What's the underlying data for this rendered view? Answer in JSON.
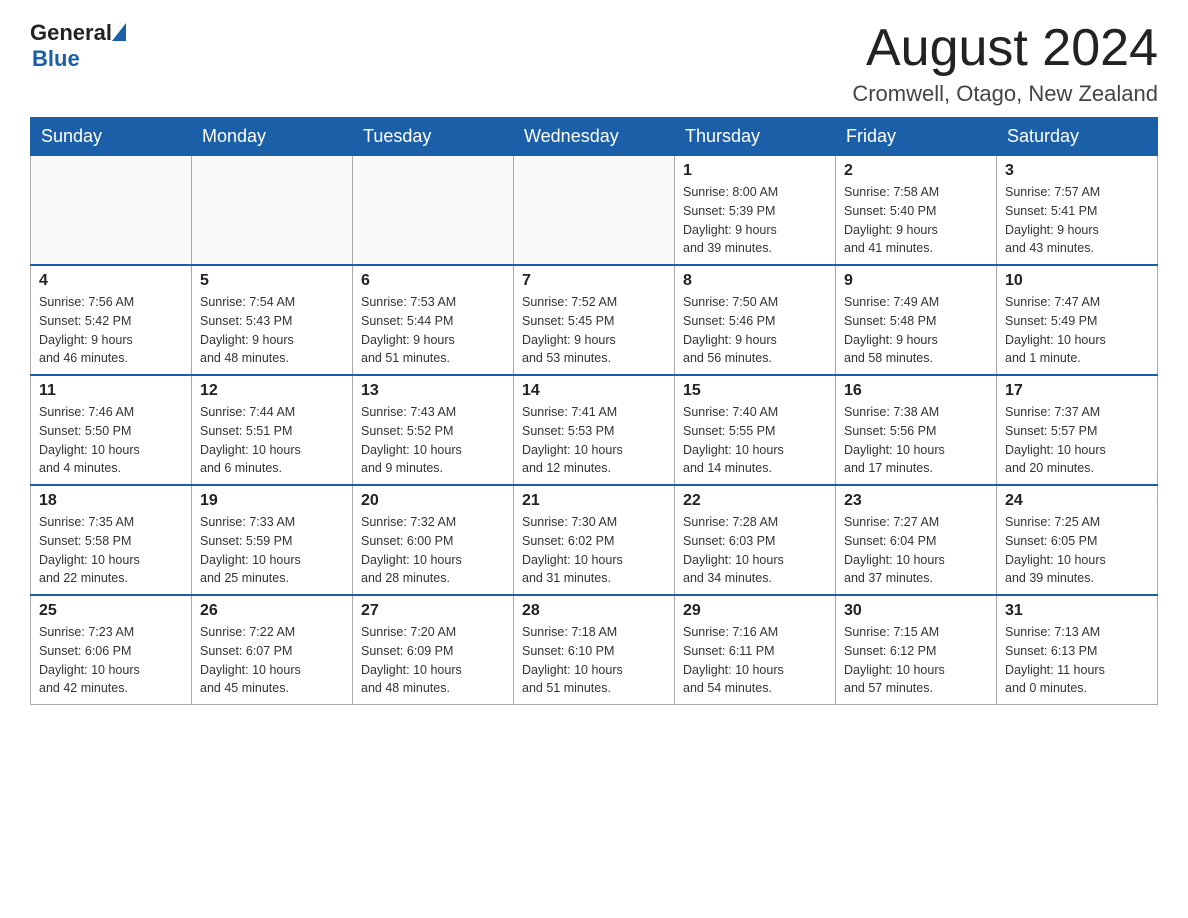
{
  "header": {
    "logo_general": "General",
    "logo_blue": "Blue",
    "month_title": "August 2024",
    "location": "Cromwell, Otago, New Zealand"
  },
  "weekdays": [
    "Sunday",
    "Monday",
    "Tuesday",
    "Wednesday",
    "Thursday",
    "Friday",
    "Saturday"
  ],
  "weeks": [
    [
      {
        "day": "",
        "info": ""
      },
      {
        "day": "",
        "info": ""
      },
      {
        "day": "",
        "info": ""
      },
      {
        "day": "",
        "info": ""
      },
      {
        "day": "1",
        "info": "Sunrise: 8:00 AM\nSunset: 5:39 PM\nDaylight: 9 hours\nand 39 minutes."
      },
      {
        "day": "2",
        "info": "Sunrise: 7:58 AM\nSunset: 5:40 PM\nDaylight: 9 hours\nand 41 minutes."
      },
      {
        "day": "3",
        "info": "Sunrise: 7:57 AM\nSunset: 5:41 PM\nDaylight: 9 hours\nand 43 minutes."
      }
    ],
    [
      {
        "day": "4",
        "info": "Sunrise: 7:56 AM\nSunset: 5:42 PM\nDaylight: 9 hours\nand 46 minutes."
      },
      {
        "day": "5",
        "info": "Sunrise: 7:54 AM\nSunset: 5:43 PM\nDaylight: 9 hours\nand 48 minutes."
      },
      {
        "day": "6",
        "info": "Sunrise: 7:53 AM\nSunset: 5:44 PM\nDaylight: 9 hours\nand 51 minutes."
      },
      {
        "day": "7",
        "info": "Sunrise: 7:52 AM\nSunset: 5:45 PM\nDaylight: 9 hours\nand 53 minutes."
      },
      {
        "day": "8",
        "info": "Sunrise: 7:50 AM\nSunset: 5:46 PM\nDaylight: 9 hours\nand 56 minutes."
      },
      {
        "day": "9",
        "info": "Sunrise: 7:49 AM\nSunset: 5:48 PM\nDaylight: 9 hours\nand 58 minutes."
      },
      {
        "day": "10",
        "info": "Sunrise: 7:47 AM\nSunset: 5:49 PM\nDaylight: 10 hours\nand 1 minute."
      }
    ],
    [
      {
        "day": "11",
        "info": "Sunrise: 7:46 AM\nSunset: 5:50 PM\nDaylight: 10 hours\nand 4 minutes."
      },
      {
        "day": "12",
        "info": "Sunrise: 7:44 AM\nSunset: 5:51 PM\nDaylight: 10 hours\nand 6 minutes."
      },
      {
        "day": "13",
        "info": "Sunrise: 7:43 AM\nSunset: 5:52 PM\nDaylight: 10 hours\nand 9 minutes."
      },
      {
        "day": "14",
        "info": "Sunrise: 7:41 AM\nSunset: 5:53 PM\nDaylight: 10 hours\nand 12 minutes."
      },
      {
        "day": "15",
        "info": "Sunrise: 7:40 AM\nSunset: 5:55 PM\nDaylight: 10 hours\nand 14 minutes."
      },
      {
        "day": "16",
        "info": "Sunrise: 7:38 AM\nSunset: 5:56 PM\nDaylight: 10 hours\nand 17 minutes."
      },
      {
        "day": "17",
        "info": "Sunrise: 7:37 AM\nSunset: 5:57 PM\nDaylight: 10 hours\nand 20 minutes."
      }
    ],
    [
      {
        "day": "18",
        "info": "Sunrise: 7:35 AM\nSunset: 5:58 PM\nDaylight: 10 hours\nand 22 minutes."
      },
      {
        "day": "19",
        "info": "Sunrise: 7:33 AM\nSunset: 5:59 PM\nDaylight: 10 hours\nand 25 minutes."
      },
      {
        "day": "20",
        "info": "Sunrise: 7:32 AM\nSunset: 6:00 PM\nDaylight: 10 hours\nand 28 minutes."
      },
      {
        "day": "21",
        "info": "Sunrise: 7:30 AM\nSunset: 6:02 PM\nDaylight: 10 hours\nand 31 minutes."
      },
      {
        "day": "22",
        "info": "Sunrise: 7:28 AM\nSunset: 6:03 PM\nDaylight: 10 hours\nand 34 minutes."
      },
      {
        "day": "23",
        "info": "Sunrise: 7:27 AM\nSunset: 6:04 PM\nDaylight: 10 hours\nand 37 minutes."
      },
      {
        "day": "24",
        "info": "Sunrise: 7:25 AM\nSunset: 6:05 PM\nDaylight: 10 hours\nand 39 minutes."
      }
    ],
    [
      {
        "day": "25",
        "info": "Sunrise: 7:23 AM\nSunset: 6:06 PM\nDaylight: 10 hours\nand 42 minutes."
      },
      {
        "day": "26",
        "info": "Sunrise: 7:22 AM\nSunset: 6:07 PM\nDaylight: 10 hours\nand 45 minutes."
      },
      {
        "day": "27",
        "info": "Sunrise: 7:20 AM\nSunset: 6:09 PM\nDaylight: 10 hours\nand 48 minutes."
      },
      {
        "day": "28",
        "info": "Sunrise: 7:18 AM\nSunset: 6:10 PM\nDaylight: 10 hours\nand 51 minutes."
      },
      {
        "day": "29",
        "info": "Sunrise: 7:16 AM\nSunset: 6:11 PM\nDaylight: 10 hours\nand 54 minutes."
      },
      {
        "day": "30",
        "info": "Sunrise: 7:15 AM\nSunset: 6:12 PM\nDaylight: 10 hours\nand 57 minutes."
      },
      {
        "day": "31",
        "info": "Sunrise: 7:13 AM\nSunset: 6:13 PM\nDaylight: 11 hours\nand 0 minutes."
      }
    ]
  ]
}
